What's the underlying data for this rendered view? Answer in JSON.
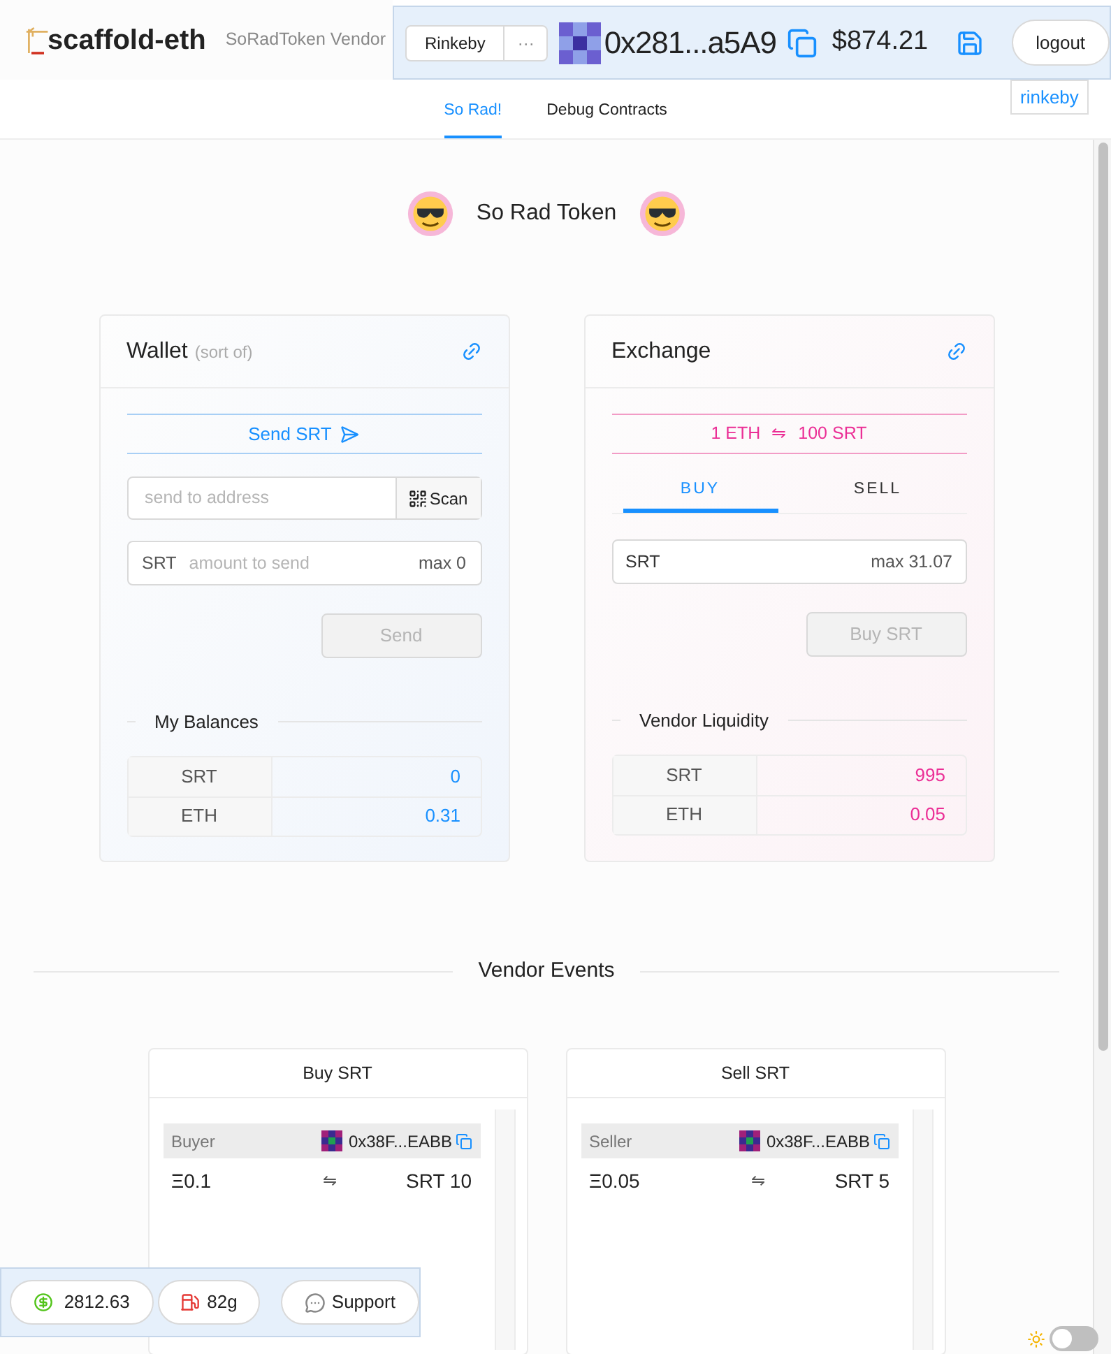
{
  "header": {
    "logo": "scaffold-eth",
    "subtitle": "SoRadToken Vendor",
    "network_button": "Rinkeby",
    "more_button": "···",
    "address": "0x281...a5A9",
    "balance": "$874.21",
    "logout": "logout",
    "network_badge": "rinkeby"
  },
  "nav_tabs": [
    {
      "label": "So Rad!",
      "selected": true
    },
    {
      "label": "Debug Contracts",
      "selected": false
    }
  ],
  "title": "So Rad Token",
  "wallet": {
    "title": "Wallet",
    "subtitle": "(sort of)",
    "send_label": "Send SRT",
    "address_placeholder": "send to address",
    "scan_label": "Scan",
    "amount_prefix": "SRT",
    "amount_placeholder": "amount to send",
    "max_label": "max 0",
    "send_button": {
      "label": "Send",
      "disabled": true
    },
    "balances_title": "My Balances",
    "balances": [
      {
        "token": "SRT",
        "value": "0"
      },
      {
        "token": "ETH",
        "value": "0.31"
      }
    ]
  },
  "exchange": {
    "title": "Exchange",
    "rate_left": "1 ETH",
    "rate_symbol": "⇋",
    "rate_right": "100 SRT",
    "tabs": [
      {
        "label": "BUY",
        "selected": true
      },
      {
        "label": "SELL",
        "selected": false
      }
    ],
    "input_prefix": "SRT",
    "max_label": "max 31.07",
    "buy_button": {
      "label": "Buy SRT",
      "disabled": true
    },
    "liquidity_title": "Vendor Liquidity",
    "liquidity": [
      {
        "token": "SRT",
        "value": "995"
      },
      {
        "token": "ETH",
        "value": "0.05"
      }
    ]
  },
  "events": {
    "title": "Vendor Events",
    "panels": [
      {
        "title": "Buy SRT",
        "role": "Buyer",
        "address": "0x38F...EABB",
        "eth": "Ξ0.1",
        "arrow": "⇋",
        "srt": "SRT 10"
      },
      {
        "title": "Sell SRT",
        "role": "Seller",
        "address": "0x38F...EABB",
        "eth": "Ξ0.05",
        "arrow": "⇋",
        "srt": "SRT 5"
      }
    ]
  },
  "footer": {
    "price": "2812.63",
    "gas": "82g",
    "support": "Support"
  },
  "theme_toggle": {
    "on": false
  }
}
